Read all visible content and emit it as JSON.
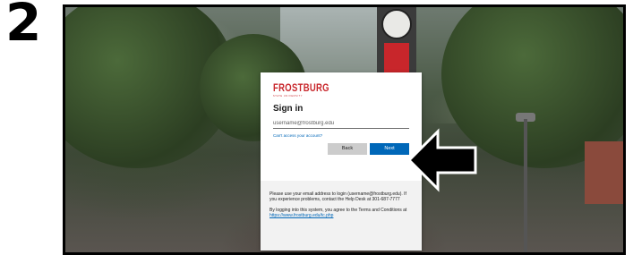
{
  "step_number": "2",
  "signin": {
    "logo_text": "FROSTBURG",
    "logo_subtext": "STATE UNIVERSITY",
    "title": "Sign in",
    "email_placeholder": "username@frostburg.edu",
    "cant_access_link": "Can't access your account?",
    "back_label": "Back",
    "next_label": "Next",
    "info_text": "Please use your email address to login (username@frostburg.edu). If you experience problems, contact the Help Desk at 301-687-7777",
    "terms_prefix": "By logging into this system, you agree to the Terms and Conditions at",
    "terms_link": "https://www.frostburg.edu/tc.php"
  },
  "colors": {
    "brand": "#c8262b",
    "accent": "#0067b8",
    "arrow": "#000000"
  },
  "icons": {
    "pointer": "arrow-left-icon"
  }
}
